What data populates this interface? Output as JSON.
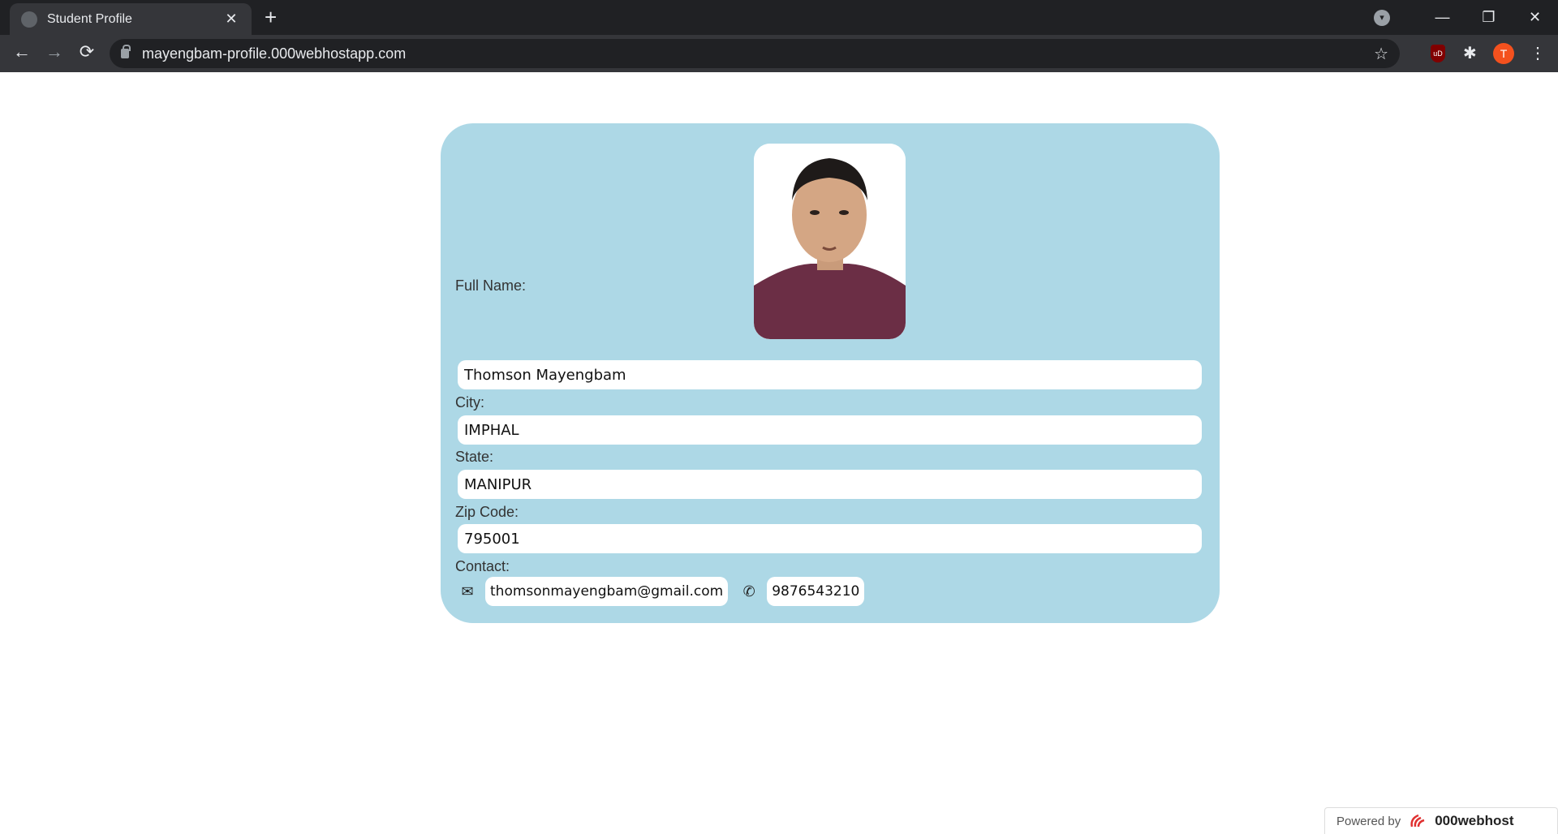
{
  "browser": {
    "tab_title": "Student Profile",
    "tab_close": "✕",
    "new_tab": "+",
    "url": "mayengbam-profile.000webhostapp.com",
    "avatar_letter": "T",
    "window_minimize": "—",
    "window_restore": "❐",
    "window_close": "✕",
    "back": "←",
    "forward": "→",
    "reload": "⟳",
    "star": "☆",
    "puzzle": "✱",
    "menu": "⋮",
    "ublock_label": "uD"
  },
  "profile": {
    "full_name_label": "Full Name:",
    "full_name": "Thomson Mayengbam",
    "city_label": "City:",
    "city": "IMPHAL",
    "state_label": "State:",
    "state": "MANIPUR",
    "zip_label": "Zip Code:",
    "zip": "795001",
    "contact_label": "Contact:",
    "email": "thomsonmayengbam@gmail.com",
    "phone": "9876543210",
    "email_icon": "✉",
    "phone_icon": "✆"
  },
  "footer": {
    "powered_by": "Powered by",
    "brand": "000webhost"
  },
  "colors": {
    "card_bg": "#add8e6",
    "chrome_dark": "#202124",
    "chrome_mid": "#35363a",
    "avatar": "#f4511e"
  }
}
